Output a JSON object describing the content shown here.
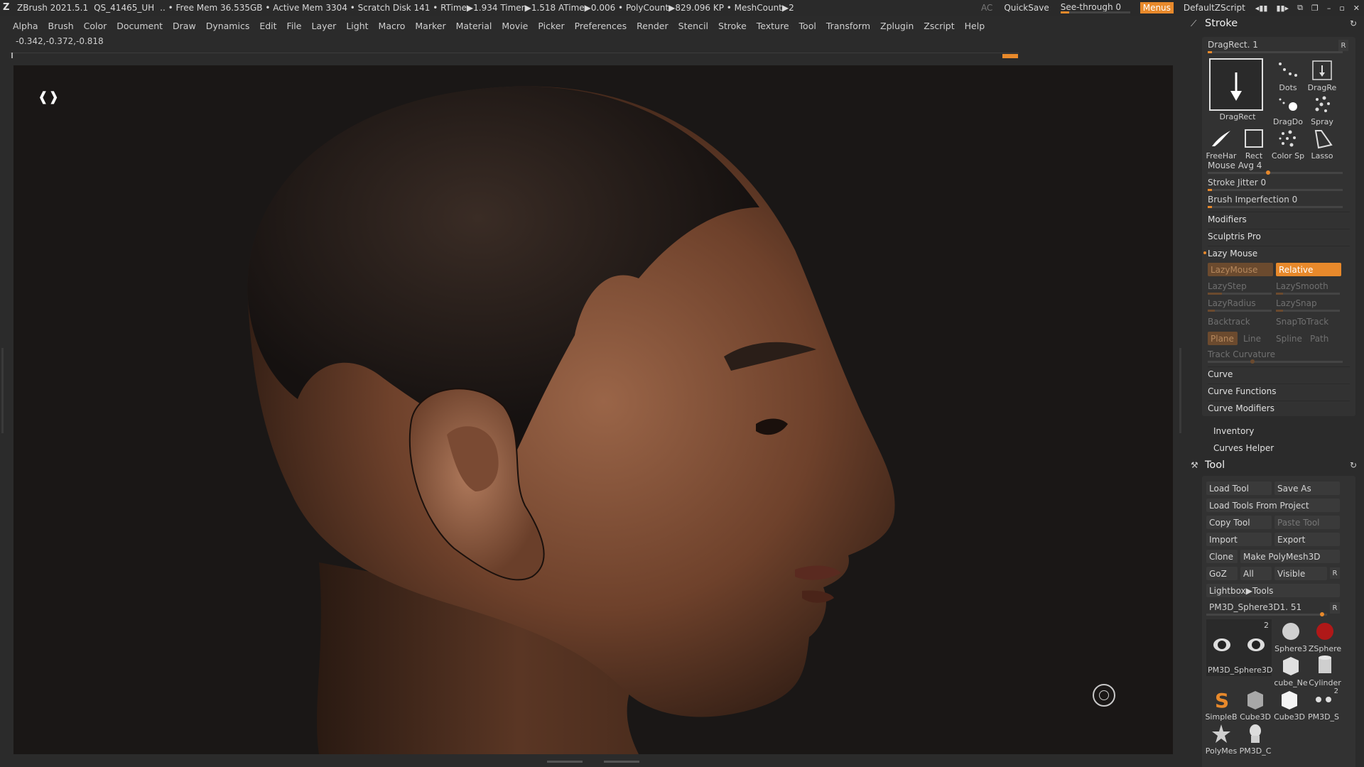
{
  "titlebar": {
    "app": "ZBrush 2021.5.1",
    "doc": "QS_41465_UH",
    "status": ".. • Free Mem 36.535GB • Active Mem 3304 • Scratch Disk 141 • RTime▶1.934 Timer▶1.518 ATime▶0.006 • PolyCount▶829.096 KP • MeshCount▶2",
    "ac": "AC",
    "quicksave": "QuickSave",
    "seethrough": "See-through  0",
    "menus": "Menus",
    "script": "DefaultZScript"
  },
  "menubar": [
    "Alpha",
    "Brush",
    "Color",
    "Document",
    "Draw",
    "Dynamics",
    "Edit",
    "File",
    "Layer",
    "Light",
    "Macro",
    "Marker",
    "Material",
    "Movie",
    "Picker",
    "Preferences",
    "Render",
    "Stencil",
    "Stroke",
    "Texture",
    "Tool",
    "Transform",
    "Zplugin",
    "Zscript",
    "Help"
  ],
  "coords": "-0.342,-0.372,-0.818",
  "canvas": {
    "frame_icon": "❰❱"
  },
  "stroke": {
    "title": "Stroke",
    "current": "DragRect. 1",
    "r": "R",
    "big_tile": "DragRect",
    "tiles": [
      {
        "label": "Dots"
      },
      {
        "label": "DragRe"
      },
      {
        "label": "DragDo"
      },
      {
        "label": "Spray"
      },
      {
        "label": "FreeHar"
      },
      {
        "label": "Rect"
      },
      {
        "label": "Color Sp"
      },
      {
        "label": "Lasso"
      }
    ],
    "mouse_avg": "Mouse Avg 4",
    "mouse_avg_value": 4,
    "stroke_jitter": "Stroke Jitter 0",
    "brush_imperfection": "Brush Imperfection 0",
    "modifiers": "Modifiers",
    "sculptris": "Sculptris Pro",
    "lazy_mouse": "Lazy Mouse",
    "lazymouse_btn": "LazyMouse",
    "relative_btn": "Relative",
    "lazystep": "LazyStep",
    "lazysmooth": "LazySmooth",
    "lazyradius": "LazyRadius",
    "lazysnap": "LazySnap",
    "backtrack": "Backtrack",
    "snaptotrack": "SnapToTrack",
    "plane": "Plane",
    "line": "Line",
    "spline": "Spline",
    "path": "Path",
    "track_curvature": "Track Curvature",
    "curve": "Curve",
    "curve_functions": "Curve Functions",
    "curve_modifiers": "Curve Modifiers",
    "inventory": "Inventory",
    "curves_helper": "Curves Helper"
  },
  "tool": {
    "title": "Tool",
    "load_tool": "Load Tool",
    "save_as": "Save As",
    "load_from_project": "Load Tools From Project",
    "copy_tool": "Copy Tool",
    "paste_tool": "Paste Tool",
    "import": "Import",
    "export": "Export",
    "clone": "Clone",
    "make_polymesh": "Make PolyMesh3D",
    "goz": "GoZ",
    "all": "All",
    "visible": "Visible",
    "r": "R",
    "lightbox": "Lightbox▶Tools",
    "current": "PM3D_Sphere3D1. 51",
    "current_count": "2",
    "tiles": [
      {
        "label": "PM3D_Sphere3D"
      },
      {
        "label": "Sphere3"
      },
      {
        "label": "ZSphere"
      },
      {
        "label": "cube_Ne"
      },
      {
        "label": "Cylinder"
      },
      {
        "label": "SimpleB"
      },
      {
        "label": "Cube3D"
      },
      {
        "label": "Cube3D"
      },
      {
        "label": "PM3D_S"
      },
      {
        "label": "PolyMes"
      },
      {
        "label": "PM3D_C"
      }
    ],
    "pm3d_count": "2"
  },
  "colors": {
    "accent": "#e8892b",
    "panel": "#2b2b2b",
    "canvas": "#1a1716"
  }
}
